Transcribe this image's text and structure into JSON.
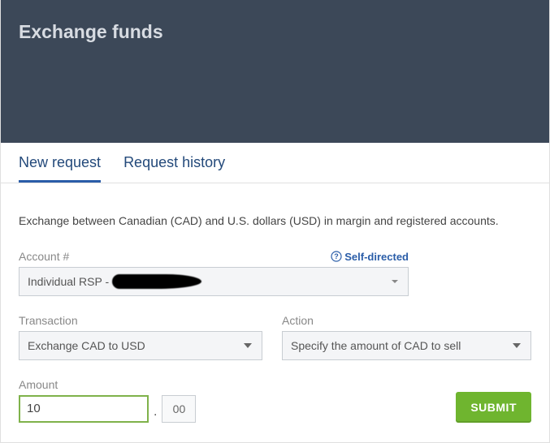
{
  "header": {
    "title": "Exchange funds"
  },
  "tabs": {
    "new_request": "New request",
    "history": "Request history"
  },
  "description": "Exchange between Canadian (CAD) and U.S. dollars (USD) in margin and registered accounts.",
  "account": {
    "label": "Account #",
    "self_directed": "Self-directed",
    "selected_prefix": "Individual RSP -"
  },
  "transaction": {
    "label": "Transaction",
    "selected": "Exchange CAD to USD"
  },
  "action": {
    "label": "Action",
    "selected": "Specify the amount of CAD to sell"
  },
  "amount": {
    "label": "Amount",
    "int_value": "10",
    "dec_value": "00"
  },
  "buttons": {
    "submit": "SUBMIT"
  }
}
